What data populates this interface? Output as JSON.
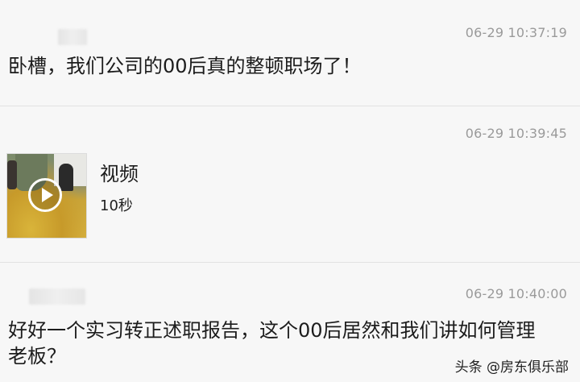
{
  "messages": [
    {
      "timestamp": "06-29 10:37:19",
      "text": "卧槽，我们公司的00后真的整顿职场了！"
    },
    {
      "timestamp": "06-29 10:39:45",
      "video": {
        "title": "视频",
        "duration": "10秒",
        "play_icon": "play-circle-icon"
      }
    },
    {
      "timestamp": "06-29 10:40:00",
      "text_line1": "好好一个实习转正述职报告，这个00后居然和我们讲如何管理",
      "text_line2": "老板？"
    }
  ],
  "watermark": {
    "label": "头条 @房东俱乐部"
  }
}
